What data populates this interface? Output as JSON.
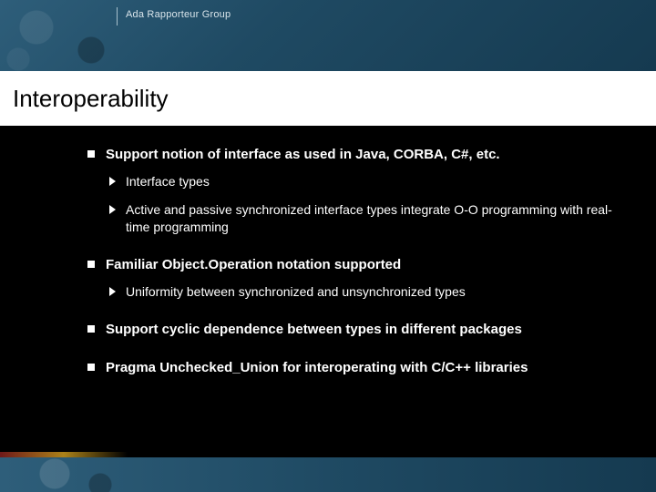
{
  "header": {
    "group": "Ada Rapporteur Group"
  },
  "title": "Interoperability",
  "bullets": [
    {
      "text": "Support notion of interface as used in Java, CORBA, C#, etc.",
      "sub": [
        "Interface types",
        "Active and passive synchronized interface types integrate O-O programming with real-time programming"
      ]
    },
    {
      "text": "Familiar Object.Operation notation supported",
      "sub": [
        "Uniformity between synchronized and unsynchronized types"
      ]
    },
    {
      "text": "Support cyclic dependence between types in different packages",
      "sub": []
    },
    {
      "text": "Pragma Unchecked_Union for interoperating with C/C++ libraries",
      "sub": []
    }
  ]
}
